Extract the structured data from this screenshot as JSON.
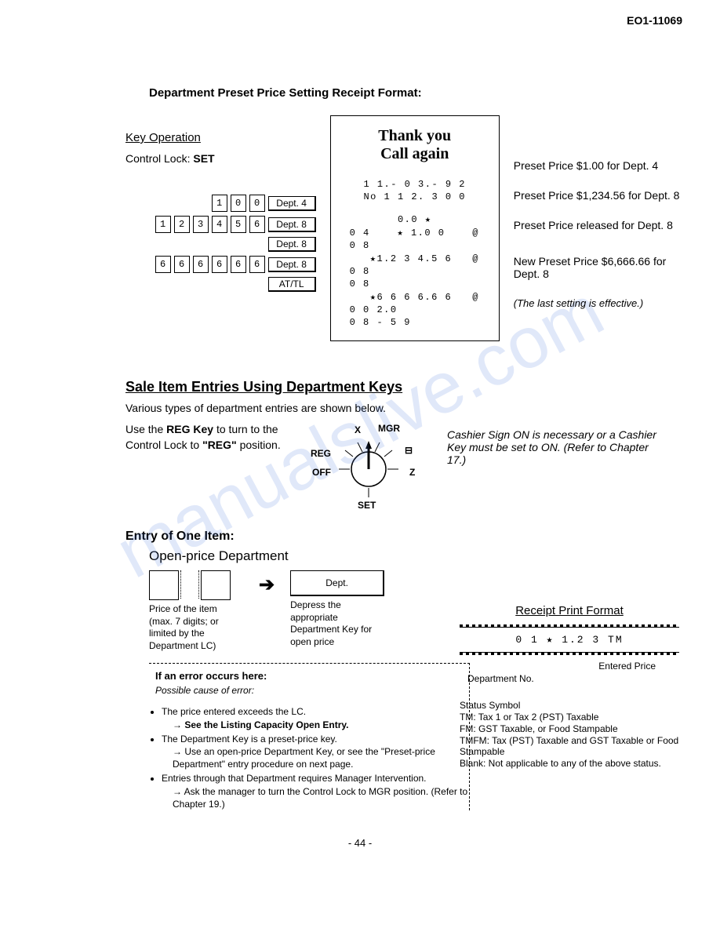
{
  "doc_id": "EO1-11069",
  "section1_title": "Department Preset Price Setting Receipt Format:",
  "key_ops": {
    "heading": "Key Operation",
    "control_lock_label": "Control Lock: ",
    "control_lock_value": "SET"
  },
  "key_rows": [
    {
      "digits": [
        "1",
        "0",
        "0"
      ],
      "dept": "Dept. 4"
    },
    {
      "digits": [
        "1",
        "2",
        "3",
        "4",
        "5",
        "6"
      ],
      "dept": "Dept. 8"
    },
    {
      "digits": [],
      "dept": "Dept. 8"
    },
    {
      "digits": [
        "6",
        "6",
        "6",
        "6",
        "6",
        "6"
      ],
      "dept": "Dept. 8"
    },
    {
      "digits": [],
      "dept": "AT/TL"
    }
  ],
  "receipt": {
    "line1": "Thank you",
    "line2": "Call  again",
    "date": "1 1.- 0 3.- 9 2",
    "no": "No 1 1 2. 3 0 0",
    "zero": "0.0 ★",
    "rows": [
      "0 4    ★ 1.0 0    @",
      "0 8",
      "   ★1.2 3 4.5 6   @",
      "0 8",
      "0 8",
      "   ★6 6 6 6.6 6   @",
      "0 0 2.0",
      "0 8 - 5 9"
    ]
  },
  "callouts": {
    "c1": "Preset Price $1.00 for Dept. 4",
    "c2": "Preset Price $1,234.56 for Dept. 8",
    "c3": "Preset Price released for Dept. 8",
    "c4": "New Preset Price $6,666.66 for Dept. 8",
    "note": "(The last setting is effective.)"
  },
  "section2_title": "Sale Item Entries Using Department Keys",
  "para1": "Various types of department entries are shown below.",
  "reg_text_1": "Use the ",
  "reg_text_bold": "REG Key",
  "reg_text_2": " to turn to the Control Lock to ",
  "reg_text_quote": "\"REG\"",
  "reg_text_3": " position.",
  "dial_labels": {
    "reg": "REG",
    "x": "X",
    "mgr": "MGR",
    "dash": "⊟",
    "z": "Z",
    "off": "OFF",
    "set": "SET"
  },
  "cashier_note": "Cashier Sign ON is necessary or a Cashier Key must be set to ON. (Refer to Chapter 17.)",
  "entry_heading": "Entry of One Item:",
  "open_price_heading": "Open-price Department",
  "caption_price": "Price of the item (max. 7 digits; or limited by the Department LC)",
  "dept_label": "Dept.",
  "caption_dept": "Depress the appropriate Department Key for open price",
  "error_heading": "If an error occurs here:",
  "error_sub": "Possible cause of error:",
  "bullets": [
    {
      "text": "The price entered exceeds the LC.",
      "sub": "See the Listing Capacity Open Entry."
    },
    {
      "text": "The Department Key is a preset-price key.",
      "sub": "Use an open-price Department Key, or see the \"Preset-price Department\" entry procedure on next page."
    },
    {
      "text": "Entries through that Department requires Manager Intervention.",
      "sub": "Ask the manager to turn the Control Lock to MGR position. (Refer to Chapter 19.)"
    }
  ],
  "rpf_title": "Receipt Print Format",
  "rpf_line": "0 1    ★ 1.2 3    TM",
  "rpf_entered": "Entered Price",
  "rpf_dept": "Department No.",
  "status_title": "Status Symbol",
  "status": [
    "TM: Tax 1 or Tax 2 (PST) Taxable",
    "FM: GST Taxable, or Food Stampable",
    "TMFM: Tax (PST) Taxable and GST Taxable or Food Stampable",
    "Blank: Not applicable to any of the above status."
  ],
  "page": "- 44 -",
  "watermark": "manualslive.com"
}
